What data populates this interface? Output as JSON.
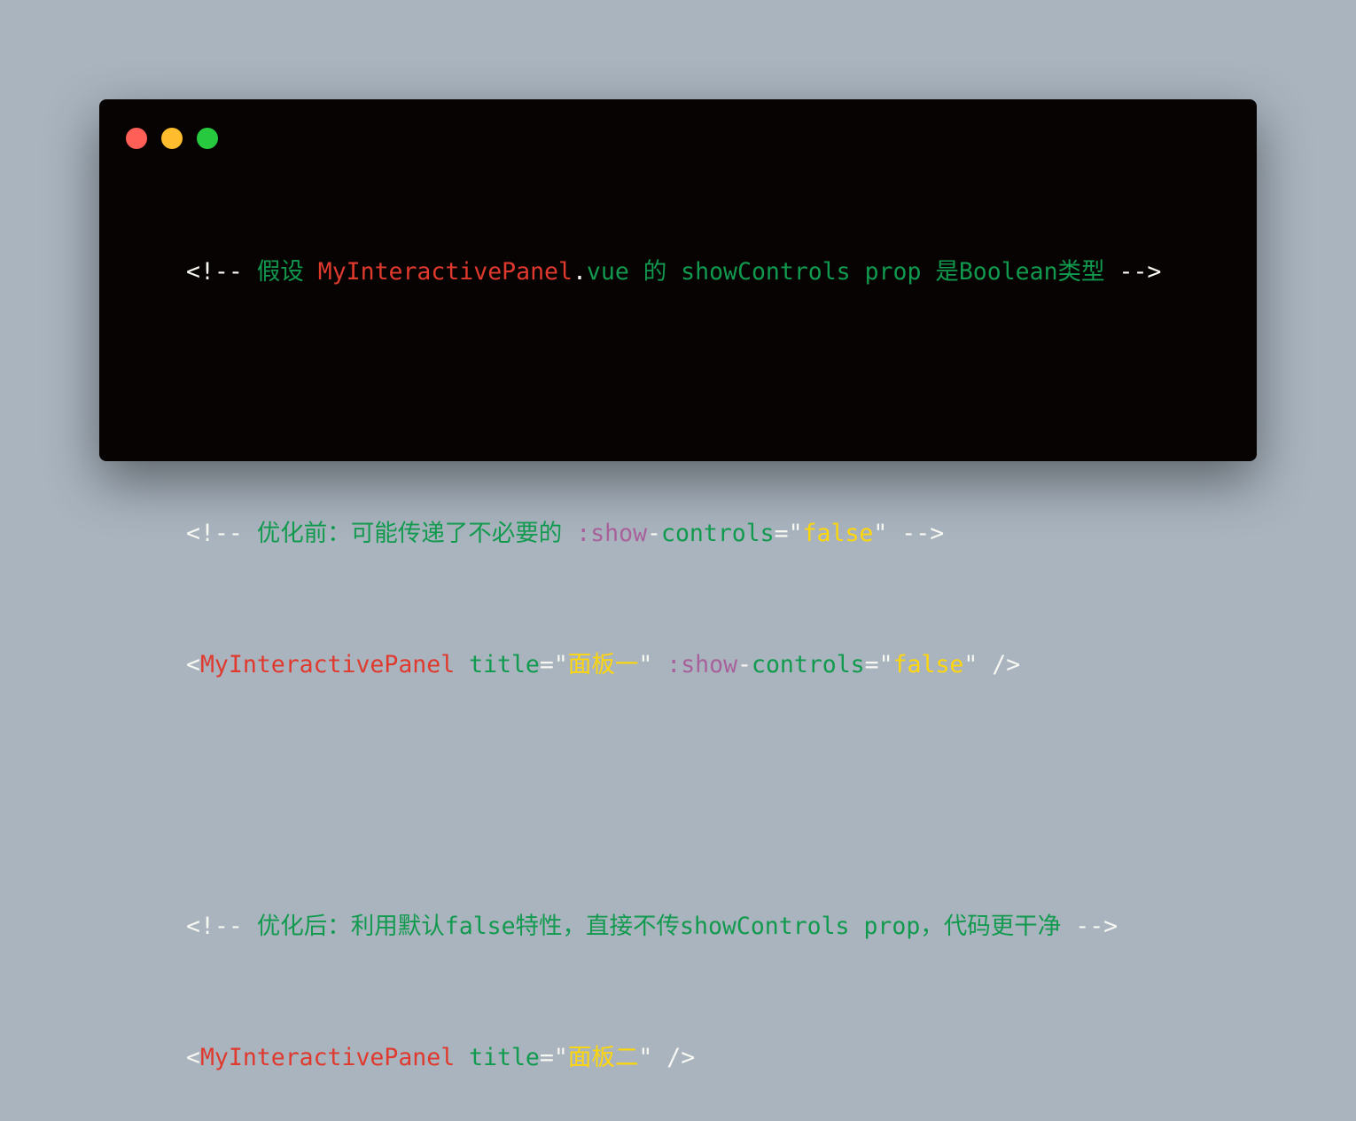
{
  "window": {
    "colors": {
      "background": "#070302",
      "close": "#ff5f56",
      "minimize": "#ffbd2e",
      "maximize": "#27c93f"
    }
  },
  "code": {
    "line1": {
      "open": "<!--",
      "text_a": " 假设 ",
      "component": "MyInteractivePanel",
      "dot": ".",
      "text_b": "vue 的 showControls prop 是Boolean类型 ",
      "close": "-->"
    },
    "line2": {
      "open": "<!--",
      "text_a": " 优化前：可能传递了不必要的 ",
      "bind": ":show",
      "dash": "-",
      "attr": "controls",
      "eq": "=",
      "q1": "\"",
      "value": "false",
      "q2": "\"",
      "close": " -->"
    },
    "line3": {
      "lt": "<",
      "tag": "MyInteractivePanel",
      "attr1": " title",
      "eq1": "=",
      "q1": "\"",
      "value1": "面板一",
      "q2": "\"",
      "bind": " :show",
      "dash": "-",
      "attr2": "controls",
      "eq2": "=",
      "q3": "\"",
      "value2": "false",
      "q4": "\"",
      "end": " />"
    },
    "line4": {
      "open": "<!--",
      "text_a": " 优化后：利用默认false特性，直接不传showControls prop，代码更干净 ",
      "close": "-->"
    },
    "line5": {
      "lt": "<",
      "tag": "MyInteractivePanel",
      "attr1": " title",
      "eq1": "=",
      "q1": "\"",
      "value1": "面板二",
      "q2": "\"",
      "end": " />"
    }
  }
}
